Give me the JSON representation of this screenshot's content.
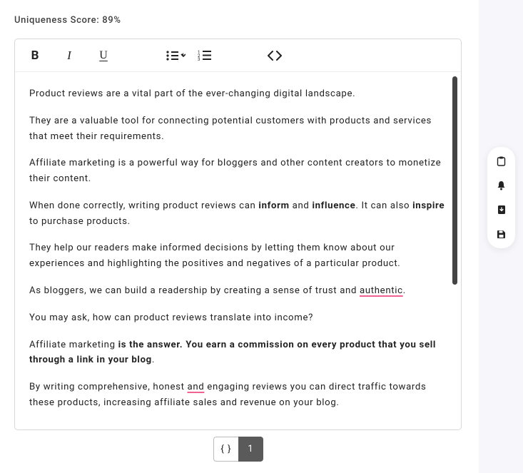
{
  "header": {
    "score_label": "Uniqueness Score: 89%"
  },
  "toolbar": {
    "bold": "B",
    "italic": "I",
    "underline": "U"
  },
  "content": {
    "paragraphs": [
      {
        "type": "plain",
        "text": "Product reviews are a vital part of the ever-changing digital landscape."
      },
      {
        "type": "plain",
        "text": "They are a valuable tool for connecting potential customers with products and services that meet their requirements."
      },
      {
        "type": "plain",
        "text": "Affiliate marketing is a powerful way for bloggers and other content creators to monetize their content."
      },
      {
        "type": "rich_p4",
        "pre1": "When done correctly, writing product reviews can ",
        "bold1": "inform",
        "mid1": " and ",
        "bold2": "influence",
        "mid2": ". It can also ",
        "bold3": "inspire",
        "post": " to purchase products."
      },
      {
        "type": "plain",
        "text": "They help our readers make informed decisions by letting them know about our experiences and highlighting the positives and negatives of a particular product."
      },
      {
        "type": "rich_p6",
        "pre": "As bloggers, we can build a readership by creating a sense of trust and ",
        "err": "authentic",
        "post": "."
      },
      {
        "type": "plain",
        "text": "You may ask, how can product reviews translate into income?"
      },
      {
        "type": "rich_p8",
        "pre": "Affiliate marketing ",
        "bold": "is the answer. You earn a commission on every product that you sell through a link in your blog",
        "post": "."
      },
      {
        "type": "rich_p9",
        "pre": "By writing comprehensive, honest ",
        "err": "and",
        "post": " engaging reviews you can direct traffic towards these products, increasing affiliate sales and revenue on your blog."
      }
    ]
  },
  "pager": {
    "braces": "{ }",
    "page": "1"
  },
  "rail": {
    "icons": [
      "clipboard-icon",
      "bell-icon",
      "download-icon",
      "save-icon"
    ]
  }
}
